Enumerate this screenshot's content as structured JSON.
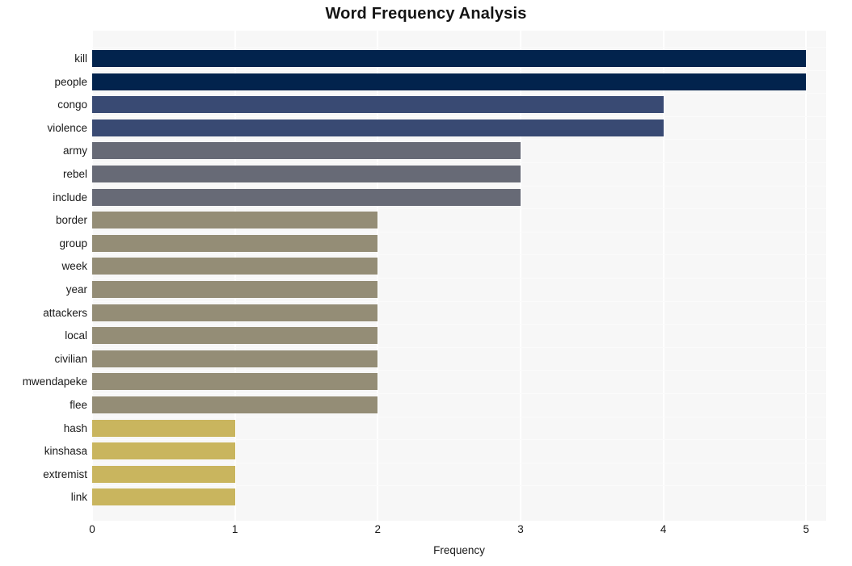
{
  "chart_data": {
    "type": "bar",
    "orientation": "horizontal",
    "title": "Word Frequency Analysis",
    "xlabel": "Frequency",
    "ylabel": "",
    "categories": [
      "kill",
      "people",
      "congo",
      "violence",
      "army",
      "rebel",
      "include",
      "border",
      "group",
      "week",
      "year",
      "attackers",
      "local",
      "civilian",
      "mwendapeke",
      "flee",
      "hash",
      "kinshasa",
      "extremist",
      "link"
    ],
    "values": [
      5,
      5,
      4,
      4,
      3,
      3,
      3,
      2,
      2,
      2,
      2,
      2,
      2,
      2,
      2,
      2,
      1,
      1,
      1,
      1
    ],
    "bar_colors": [
      "#02234d",
      "#02234d",
      "#394a73",
      "#394a73",
      "#676a76",
      "#676a76",
      "#676a76",
      "#948d76",
      "#948d76",
      "#948d76",
      "#948d76",
      "#948d76",
      "#948d76",
      "#948d76",
      "#948d76",
      "#948d76",
      "#c9b55e",
      "#c9b55e",
      "#c9b55e",
      "#c9b55e"
    ],
    "xticks": [
      0,
      1,
      2,
      3,
      4,
      5
    ],
    "xtick_labels": [
      "0",
      "1",
      "2",
      "3",
      "4",
      "5"
    ],
    "xlim": [
      0,
      5.14
    ],
    "grid": true,
    "grid_color": "#ffffff",
    "plot_background": "#f7f7f7",
    "legend": null
  }
}
